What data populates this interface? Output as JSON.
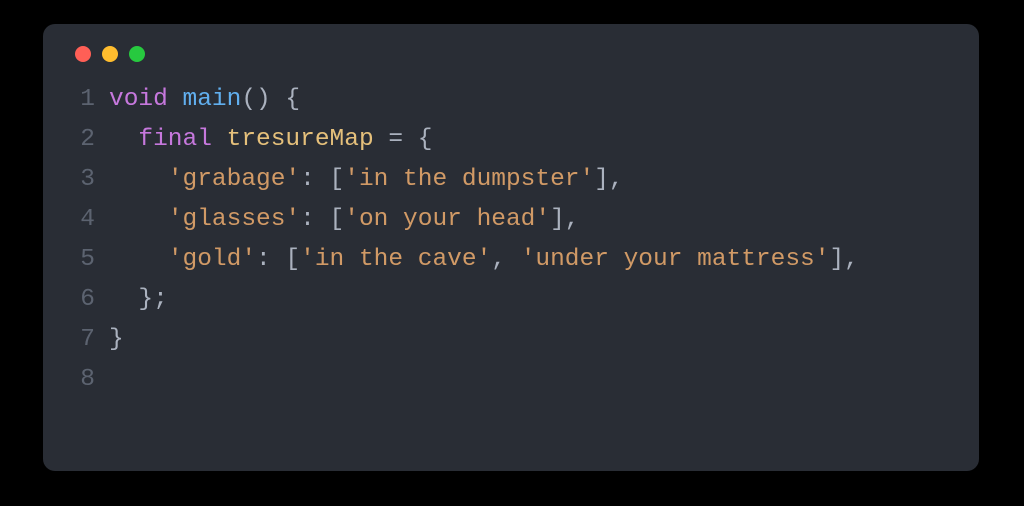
{
  "window": {
    "traffic": [
      "red",
      "yellow",
      "green"
    ]
  },
  "code": {
    "language": "dart",
    "lines": [
      {
        "num": "1",
        "indent": "",
        "tokens": [
          {
            "cls": "kw",
            "t": "void"
          },
          {
            "cls": "txt",
            "t": " "
          },
          {
            "cls": "fn",
            "t": "main"
          },
          {
            "cls": "pun",
            "t": "() {"
          }
        ]
      },
      {
        "num": "2",
        "indent": "  ",
        "tokens": [
          {
            "cls": "kw",
            "t": "final"
          },
          {
            "cls": "txt",
            "t": " "
          },
          {
            "cls": "ident",
            "t": "tresureMap"
          },
          {
            "cls": "txt",
            "t": " "
          },
          {
            "cls": "pun",
            "t": "= {"
          }
        ]
      },
      {
        "num": "3",
        "indent": "    ",
        "tokens": [
          {
            "cls": "str",
            "t": "'grabage'"
          },
          {
            "cls": "pun",
            "t": ": ["
          },
          {
            "cls": "str",
            "t": "'in the dumpster'"
          },
          {
            "cls": "pun",
            "t": "],"
          }
        ]
      },
      {
        "num": "4",
        "indent": "    ",
        "tokens": [
          {
            "cls": "str",
            "t": "'glasses'"
          },
          {
            "cls": "pun",
            "t": ": ["
          },
          {
            "cls": "str",
            "t": "'on your head'"
          },
          {
            "cls": "pun",
            "t": "],"
          }
        ]
      },
      {
        "num": "5",
        "indent": "    ",
        "tokens": [
          {
            "cls": "str",
            "t": "'gold'"
          },
          {
            "cls": "pun",
            "t": ": ["
          },
          {
            "cls": "str",
            "t": "'in the cave'"
          },
          {
            "cls": "pun",
            "t": ", "
          },
          {
            "cls": "str",
            "t": "'under your mattress'"
          },
          {
            "cls": "pun",
            "t": "],"
          }
        ]
      },
      {
        "num": "6",
        "indent": "  ",
        "tokens": [
          {
            "cls": "pun",
            "t": "};"
          }
        ]
      },
      {
        "num": "7",
        "indent": "",
        "tokens": [
          {
            "cls": "pun",
            "t": "}"
          }
        ]
      },
      {
        "num": "8",
        "indent": "",
        "tokens": []
      }
    ]
  }
}
